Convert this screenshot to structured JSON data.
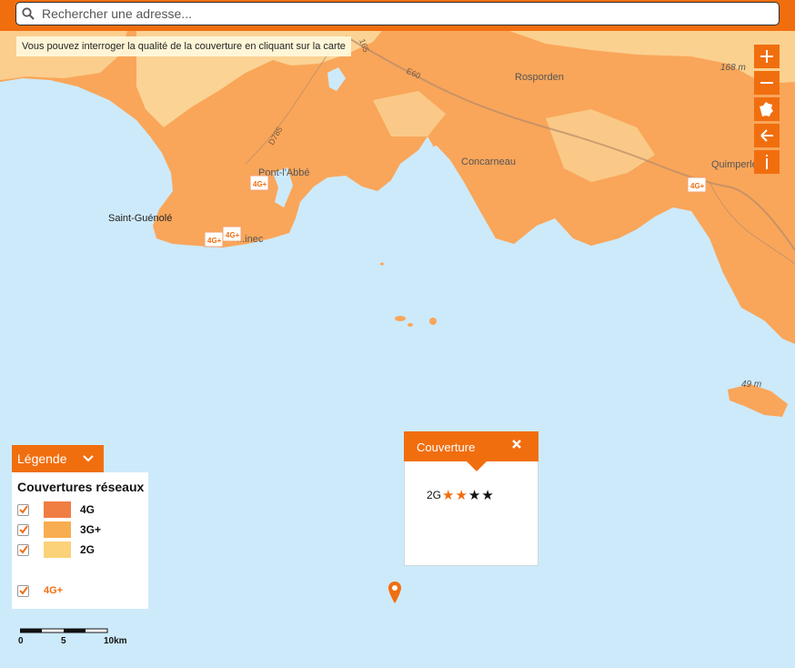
{
  "search": {
    "placeholder": "Rechercher une adresse...",
    "value": ""
  },
  "hint": "Vous pouvez interroger la qualité de la couverture en cliquant sur la carte",
  "map_controls": [
    {
      "name": "zoom-in",
      "icon": "plus-icon"
    },
    {
      "name": "zoom-out",
      "icon": "minus-icon"
    },
    {
      "name": "france-view",
      "icon": "france-map-icon"
    },
    {
      "name": "back",
      "icon": "arrow-left-icon"
    },
    {
      "name": "info",
      "icon": "info-icon"
    }
  ],
  "places": [
    "Rosporden",
    "Pont-l'Abbé",
    "Concarneau",
    "Quimperlé",
    "Saint-Guénolé",
    "...inec"
  ],
  "roads": [
    "D785",
    "E60",
    "165"
  ],
  "elevations": [
    "168 m",
    "49 m"
  ],
  "badges": [
    "4G+",
    "4G+",
    "4G+",
    "4G+"
  ],
  "legend": {
    "tab_label": "Légende",
    "title": "Couvertures réseaux",
    "items": [
      {
        "label": "4G",
        "color": "#f07d42",
        "checked": true
      },
      {
        "label": "3G+",
        "color": "#f9ad51",
        "checked": true
      },
      {
        "label": "2G",
        "color": "#fbd27a",
        "checked": true
      }
    ],
    "extra": {
      "label": "4G+",
      "checked": true
    }
  },
  "popup": {
    "title": "Couverture",
    "rows": [
      {
        "tech": "2G",
        "rating": 2,
        "max": 4
      }
    ]
  },
  "scale": {
    "labels": [
      "0",
      "5",
      "10km"
    ]
  },
  "colors": {
    "accent": "#f16e0f",
    "sea": "#cdeafa",
    "coverage_3g": "#f9a65a",
    "coverage_2g": "#fbd89a"
  }
}
